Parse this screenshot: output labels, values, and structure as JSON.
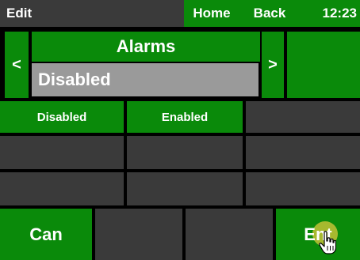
{
  "topbar": {
    "title": "Edit",
    "home_label": "Home",
    "back_label": "Back",
    "time": "12:23"
  },
  "field": {
    "title": "Alarms",
    "value": "Disabled",
    "prev_label": "<",
    "next_label": ">"
  },
  "options": [
    "Disabled",
    "Enabled"
  ],
  "bottom": {
    "cancel_label": "Can",
    "enter_label": "Ent"
  },
  "colors": {
    "button_green": "#0a8a0a",
    "empty_cell": "#3a3a3a",
    "value_field": "#9a9a9a",
    "touch_indicator": "#dcc83c"
  },
  "icons": {
    "pointer": "hand-pointer-icon"
  }
}
